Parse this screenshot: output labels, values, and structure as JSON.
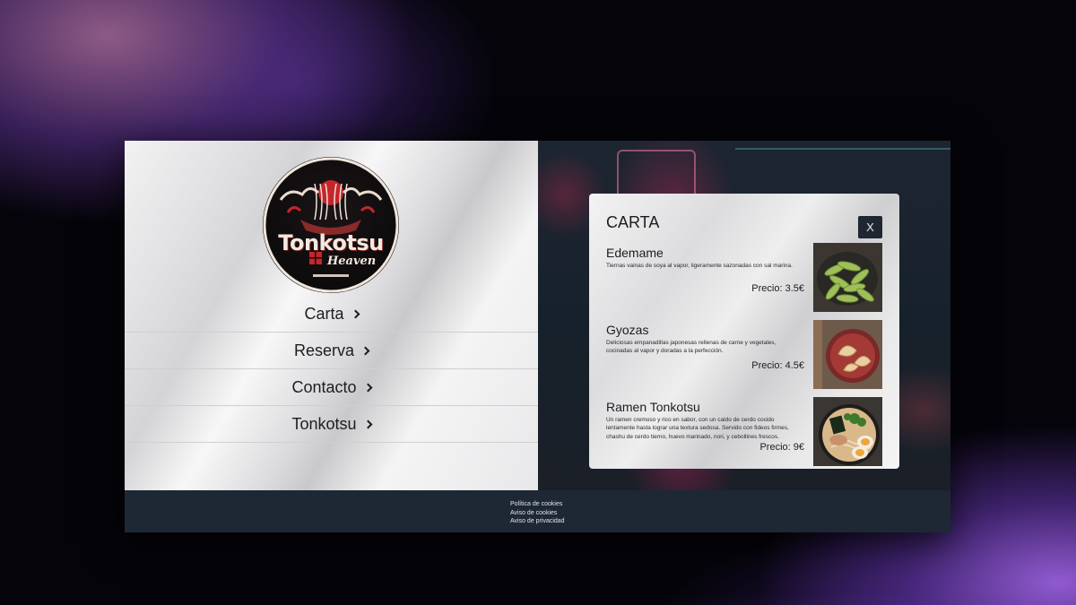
{
  "brand": {
    "title": "Tonkotsu",
    "subtitle": "Heaven"
  },
  "nav": {
    "items": [
      {
        "label": "Carta"
      },
      {
        "label": "Reserva"
      },
      {
        "label": "Contacto"
      },
      {
        "label": "Tonkotsu"
      }
    ]
  },
  "modal": {
    "title": "CARTA",
    "close_label": "X",
    "items": [
      {
        "name": "Edemame",
        "description": "Tiernas vainas de soya al vapor, ligeramente sazonadas con sal marina.",
        "price": "Precio: 3.5€",
        "image_icon": "edamame-photo"
      },
      {
        "name": "Gyozas",
        "description": "Deliciosas empanadillas japonesas rellenas de carne y vegetales, cocinadas al vapor y doradas a la perfección.",
        "price": "Precio: 4.5€",
        "image_icon": "gyoza-photo"
      },
      {
        "name": "Ramen Tonkotsu",
        "description": "Un ramen cremoso y rico en sabor, con un caldo de cerdo cocido lentamente hasta lograr una textura sedosa. Servido con fideos firmes, chashu de cerdo tierno, huevo marinado, nori, y cebollines frescos.",
        "price": "Precio: 9€",
        "image_icon": "ramen-photo"
      }
    ]
  },
  "footer": {
    "links": [
      {
        "label": "Política de cookies"
      },
      {
        "label": "Aviso de cookies"
      },
      {
        "label": "Aviso de privacidad"
      }
    ]
  },
  "colors": {
    "footer_bg": "#1e2834",
    "close_button_bg": "#1e2732",
    "text_dark": "#1d1d1f"
  }
}
